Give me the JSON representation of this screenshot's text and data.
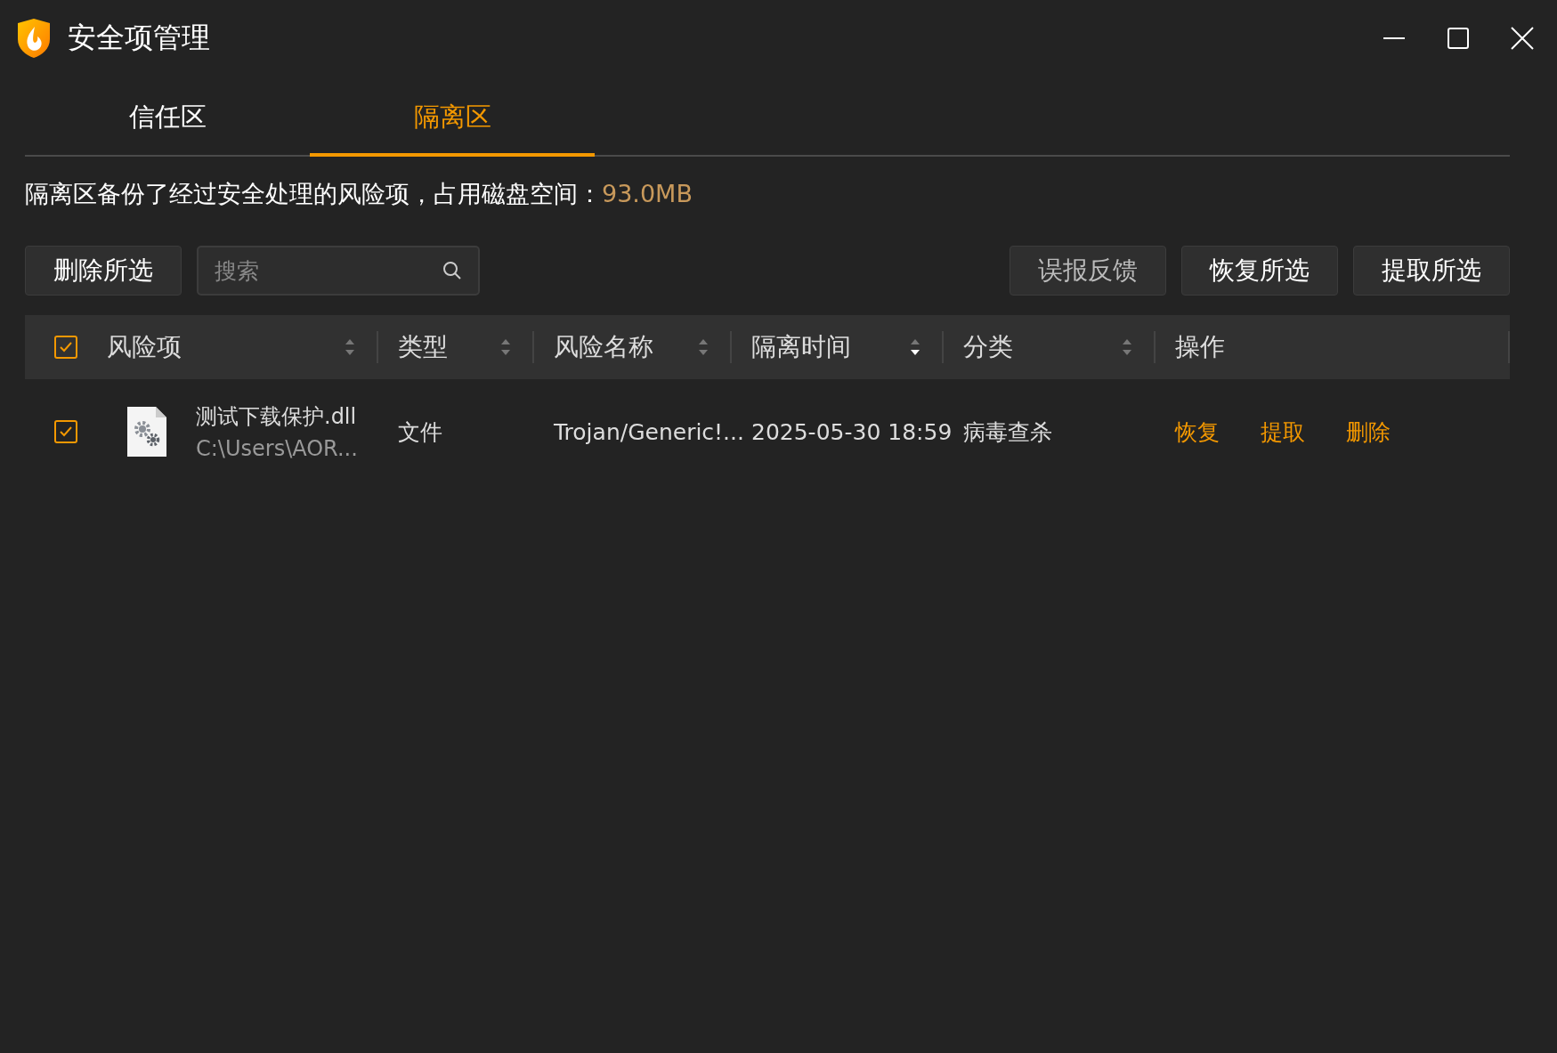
{
  "window": {
    "title": "安全项管理"
  },
  "tabs": [
    {
      "label": "信任区",
      "selected": false
    },
    {
      "label": "隔离区",
      "selected": true
    }
  ],
  "summary": {
    "text": "隔离区备份了经过安全处理的风险项，占用磁盘空间：",
    "size": "93.0MB"
  },
  "toolbar": {
    "left_button": "删除所选",
    "search": {
      "placeholder": "搜索"
    },
    "right_buttons": [
      {
        "label": "误报反馈",
        "disabled": true
      },
      {
        "label": "恢复所选",
        "disabled": false
      },
      {
        "label": "提取所选",
        "disabled": false
      }
    ]
  },
  "table": {
    "all_checked": true,
    "columns": [
      {
        "label": "风险项",
        "sortable": true,
        "sorted_desc": false
      },
      {
        "label": "类型",
        "sortable": true,
        "sorted_desc": false
      },
      {
        "label": "风险名称",
        "sortable": true,
        "sorted_desc": false
      },
      {
        "label": "隔离时间",
        "sortable": true,
        "sorted_desc": true
      },
      {
        "label": "分类",
        "sortable": true,
        "sorted_desc": false
      },
      {
        "label": "操作",
        "sortable": false
      }
    ],
    "rows": [
      {
        "checked": true,
        "file_name": "测试下载保护.dll",
        "path": "C:\\Users\\AOR...",
        "type": "文件",
        "risk_name": "Trojan/Generic!...",
        "time": "2025-05-30 18:59",
        "category": "病毒查杀",
        "actions": [
          "恢复",
          "提取",
          "删除"
        ]
      }
    ]
  }
}
